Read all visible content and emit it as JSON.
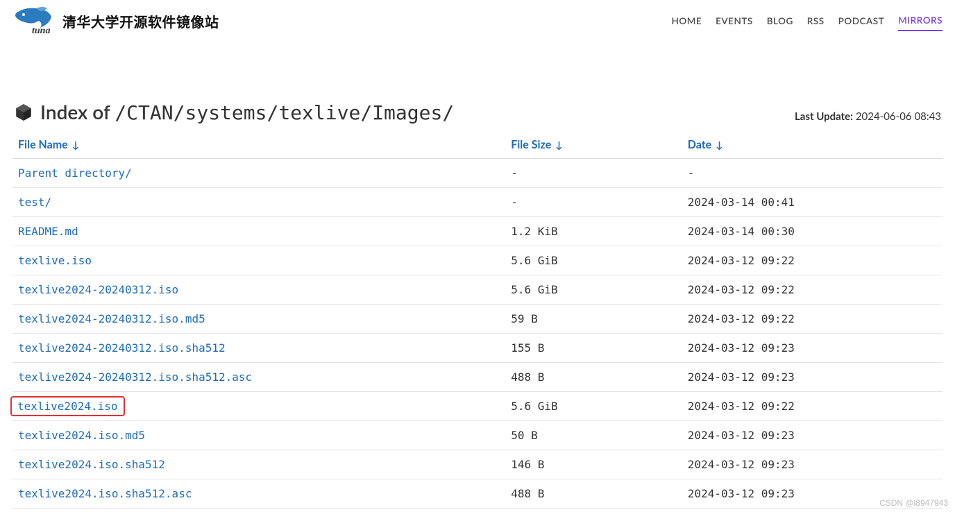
{
  "site_title": "清华大学开源软件镜像站",
  "nav": {
    "items": [
      {
        "label": "HOME",
        "active": false
      },
      {
        "label": "EVENTS",
        "active": false
      },
      {
        "label": "BLOG",
        "active": false
      },
      {
        "label": "RSS",
        "active": false
      },
      {
        "label": "PODCAST",
        "active": false
      },
      {
        "label": "MIRRORS",
        "active": true
      }
    ]
  },
  "page": {
    "index_prefix": "Index of ",
    "path": "/CTAN/systems/texlive/Images/",
    "last_update_label": "Last Update:",
    "last_update_value": "2024-06-06 08:43"
  },
  "columns": {
    "name": "File Name",
    "size": "File Size",
    "date": "Date",
    "sort_arrow": "↓"
  },
  "rows": [
    {
      "name": "Parent directory/",
      "size": "-",
      "date": "-",
      "highlight": false
    },
    {
      "name": "test/",
      "size": "-",
      "date": "2024-03-14 00:41",
      "highlight": false
    },
    {
      "name": "README.md",
      "size": "1.2 KiB",
      "date": "2024-03-14 00:30",
      "highlight": false
    },
    {
      "name": "texlive.iso",
      "size": "5.6 GiB",
      "date": "2024-03-12 09:22",
      "highlight": false
    },
    {
      "name": "texlive2024-20240312.iso",
      "size": "5.6 GiB",
      "date": "2024-03-12 09:22",
      "highlight": false
    },
    {
      "name": "texlive2024-20240312.iso.md5",
      "size": "59 B",
      "date": "2024-03-12 09:22",
      "highlight": false
    },
    {
      "name": "texlive2024-20240312.iso.sha512",
      "size": "155 B",
      "date": "2024-03-12 09:23",
      "highlight": false
    },
    {
      "name": "texlive2024-20240312.iso.sha512.asc",
      "size": "488 B",
      "date": "2024-03-12 09:23",
      "highlight": false
    },
    {
      "name": "texlive2024.iso",
      "size": "5.6 GiB",
      "date": "2024-03-12 09:22",
      "highlight": true
    },
    {
      "name": "texlive2024.iso.md5",
      "size": "50 B",
      "date": "2024-03-12 09:23",
      "highlight": false
    },
    {
      "name": "texlive2024.iso.sha512",
      "size": "146 B",
      "date": "2024-03-12 09:23",
      "highlight": false
    },
    {
      "name": "texlive2024.iso.sha512.asc",
      "size": "488 B",
      "date": "2024-03-12 09:23",
      "highlight": false
    }
  ],
  "watermark": "CSDN @l8947943"
}
